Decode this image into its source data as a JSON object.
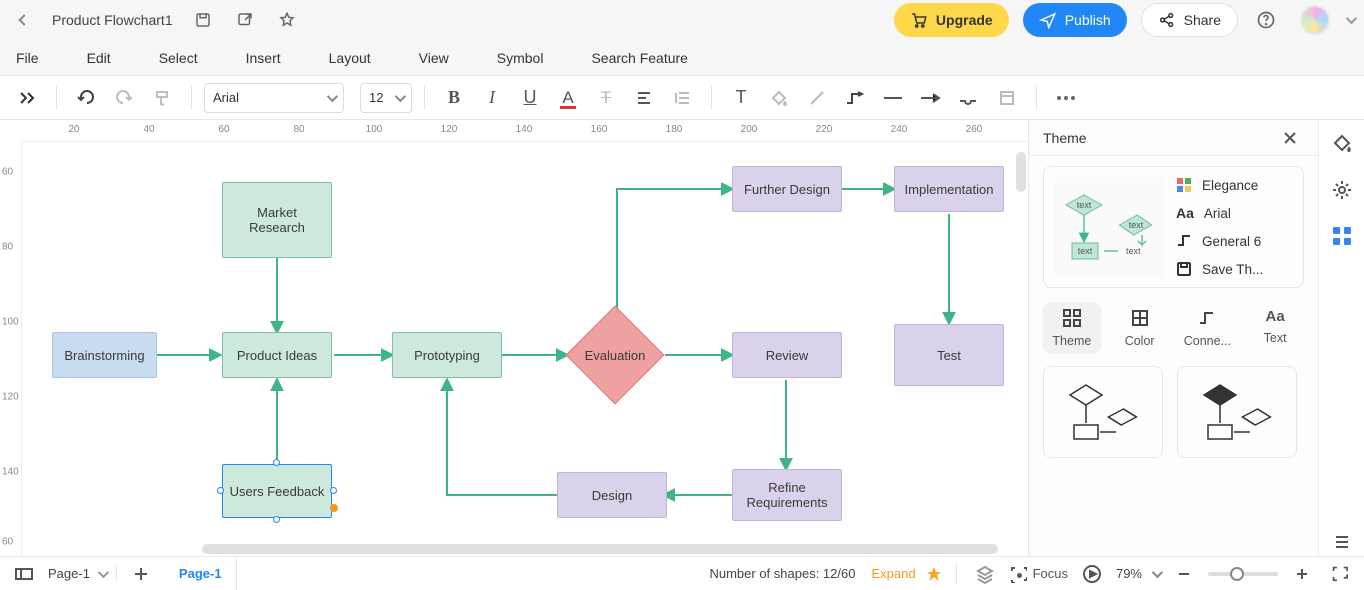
{
  "header": {
    "title": "Product Flowchart1",
    "upgrade": "Upgrade",
    "publish": "Publish",
    "share": "Share"
  },
  "menus": [
    "File",
    "Edit",
    "Select",
    "Insert",
    "Layout",
    "View",
    "Symbol",
    "Search Feature"
  ],
  "toolbar": {
    "font": "Arial",
    "size": "12"
  },
  "ruler": {
    "h": [
      "20",
      "40",
      "60",
      "80",
      "100",
      "120",
      "140",
      "160",
      "180",
      "200",
      "220",
      "240",
      "260"
    ],
    "v": [
      "60",
      "80",
      "100",
      "120",
      "140",
      "60"
    ]
  },
  "nodes": {
    "brainstorming": "Brainstorming",
    "market_research": "Market Research",
    "product_ideas": "Product Ideas",
    "users_feedback": "Users Feedback",
    "prototyping": "Prototyping",
    "evaluation": "Evaluation",
    "further_design": "Further Design",
    "review": "Review",
    "refine_req": "Refine Requirements",
    "design": "Design",
    "implementation": "Implementation",
    "test": "Test"
  },
  "theme": {
    "title": "Theme",
    "elegance": "Elegance",
    "font": "Arial",
    "connector": "General 6",
    "save": "Save Th...",
    "tabs": {
      "theme": "Theme",
      "color": "Color",
      "connector": "Conne...",
      "text": "Text"
    },
    "preview_labels": [
      "text",
      "text",
      "text",
      "text"
    ]
  },
  "status": {
    "page_select": "Page-1",
    "page_tab": "Page-1",
    "shapes_label": "Number of shapes: ",
    "shapes_count": "12/60",
    "expand": "Expand",
    "focus": "Focus",
    "zoom": "79%"
  }
}
